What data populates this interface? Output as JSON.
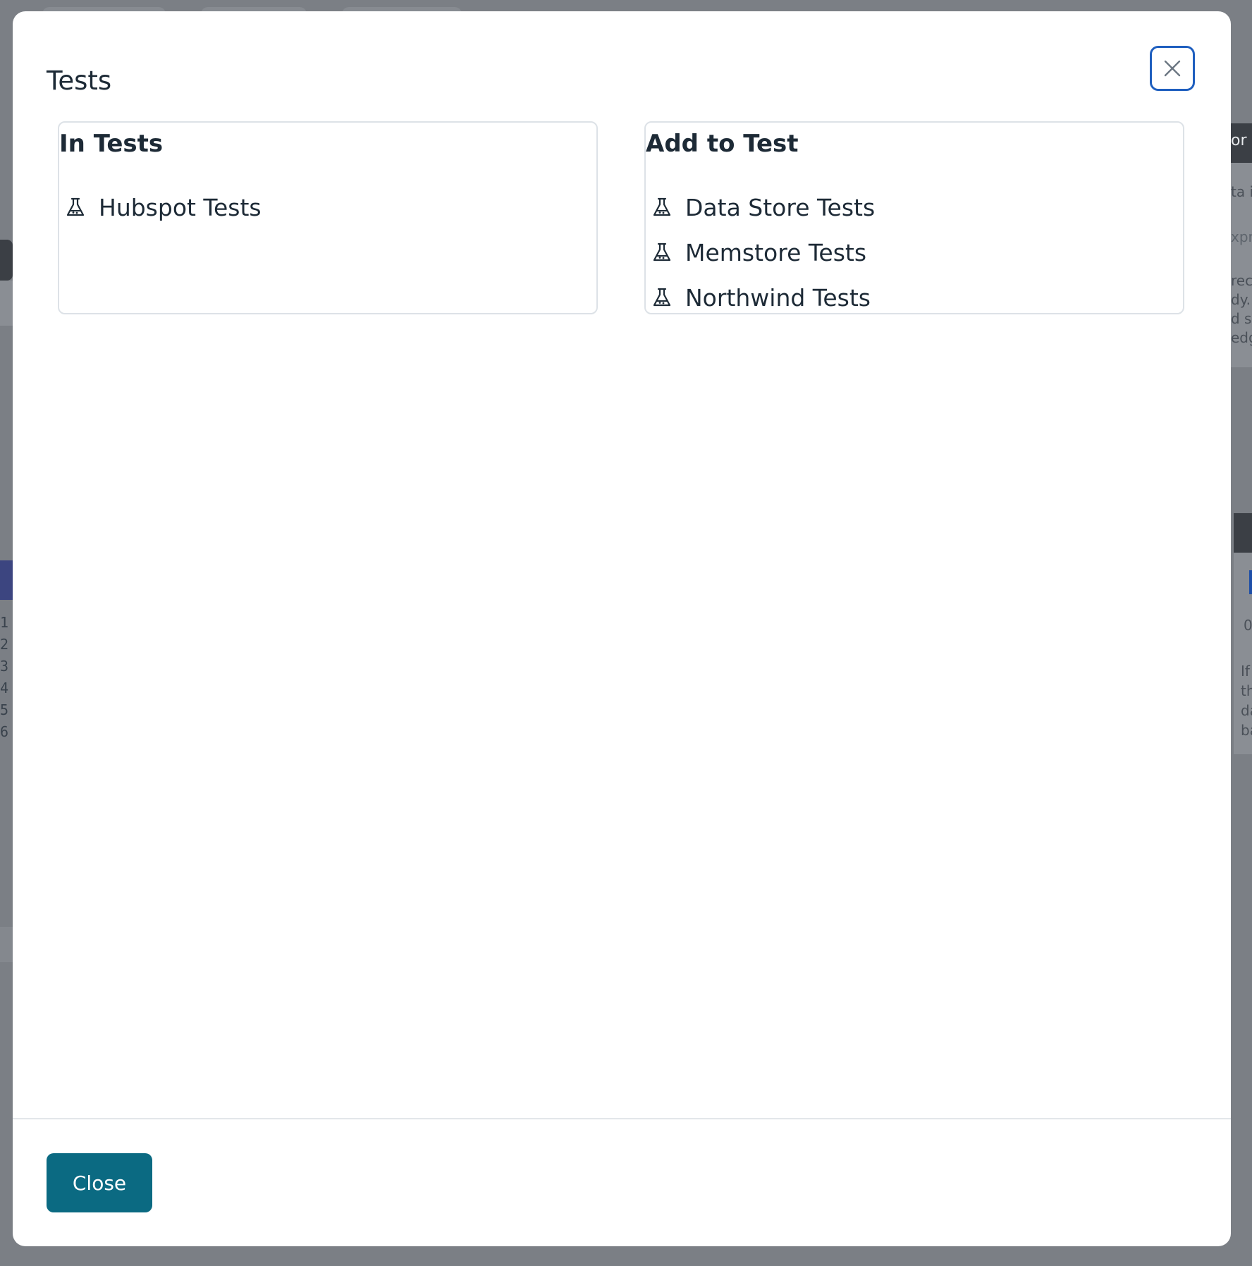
{
  "modal": {
    "title": "Tests",
    "close_icon": "close-icon",
    "in_tests": {
      "heading": "In Tests",
      "items": [
        {
          "label": "Hubspot Tests",
          "icon": "flask-icon"
        }
      ]
    },
    "add_to_test": {
      "heading": "Add to Test",
      "items": [
        {
          "label": "Data Store Tests",
          "icon": "flask-icon"
        },
        {
          "label": "Memstore Tests",
          "icon": "flask-icon"
        },
        {
          "label": "Northwind Tests",
          "icon": "flask-icon"
        }
      ]
    },
    "footer": {
      "close_label": "Close"
    }
  },
  "background": {
    "line_numbers": [
      "1",
      "2",
      "3",
      "4",
      "5",
      "6"
    ],
    "side_panel_top_label": "or",
    "side_panel_text": [
      "ta i",
      "xpr",
      "rece",
      "dy.",
      "d sr",
      "edge"
    ],
    "side_panel_lower_text": [
      "If",
      "th",
      "da",
      "ba"
    ],
    "side_panel_input": "0"
  },
  "colors": {
    "primary_button": "#0b6a82",
    "focus_ring": "#1f5fbf",
    "text": "#1d2a36",
    "border": "#dde2e7",
    "backdrop": "#7b7f85"
  }
}
